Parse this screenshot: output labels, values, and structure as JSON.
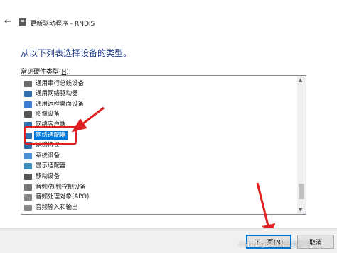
{
  "window": {
    "back_icon": "back-arrow-icon",
    "title": "更新驱动程序 - RNDIS"
  },
  "heading": "从以下列表选择设备的类型。",
  "list": {
    "label_prefix": "常见硬件类型(",
    "label_access_key": "H",
    "label_suffix": "):",
    "selected_index": 5,
    "items": [
      {
        "label": "通用串行总线设备",
        "icon": "usb-device-icon"
      },
      {
        "label": "通用网络驱动器",
        "icon": "network-drive-icon"
      },
      {
        "label": "通用远程桌面设备",
        "icon": "remote-desktop-icon"
      },
      {
        "label": "图像设备",
        "icon": "camera-icon"
      },
      {
        "label": "网络客户端",
        "icon": "network-client-icon"
      },
      {
        "label": "网络适配器",
        "icon": "network-adapter-icon"
      },
      {
        "label": "网络协议",
        "icon": "network-protocol-icon"
      },
      {
        "label": "系统设备",
        "icon": "system-device-icon"
      },
      {
        "label": "显示适配器",
        "icon": "display-adapter-icon"
      },
      {
        "label": "移动设备",
        "icon": "mobile-device-icon"
      },
      {
        "label": "音频/视频控制设备",
        "icon": "av-control-icon"
      },
      {
        "label": "音频处理对象(APO)",
        "icon": "audio-apo-icon"
      },
      {
        "label": "音频输入和输出",
        "icon": "audio-io-icon"
      }
    ]
  },
  "buttons": {
    "next": "下一页(N)",
    "cancel": "取消"
  },
  "watermark": "CSDN @太阳就是爱学习",
  "colors": {
    "accent": "#0078d7",
    "annotation": "#e02020",
    "heading": "#1e3a8a"
  }
}
